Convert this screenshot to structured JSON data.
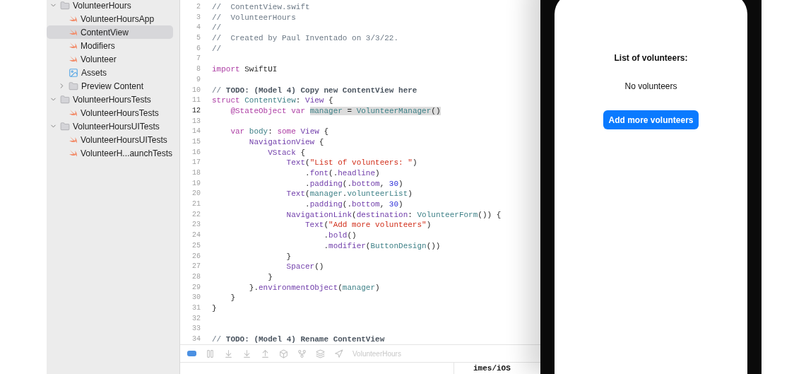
{
  "navigator": {
    "items": [
      {
        "kind": "folder",
        "label": "VolunteerHours",
        "expanded": true,
        "selected": false,
        "children": [
          {
            "kind": "swift",
            "label": "VolunteerHoursApp",
            "selected": false
          },
          {
            "kind": "swift",
            "label": "ContentView",
            "selected": true
          },
          {
            "kind": "swift",
            "label": "Modifiers",
            "selected": false
          },
          {
            "kind": "swift",
            "label": "Volunteer",
            "selected": false
          },
          {
            "kind": "assets",
            "label": "Assets",
            "selected": false
          },
          {
            "kind": "folder",
            "label": "Preview Content",
            "expanded": false,
            "selected": false
          }
        ]
      },
      {
        "kind": "folder",
        "label": "VolunteerHoursTests",
        "expanded": true,
        "selected": false,
        "children": [
          {
            "kind": "swift",
            "label": "VolunteerHoursTests",
            "selected": false
          }
        ]
      },
      {
        "kind": "folder",
        "label": "VolunteerHoursUITests",
        "expanded": true,
        "selected": false,
        "children": [
          {
            "kind": "swift",
            "label": "VolunteerHoursUITests",
            "selected": false
          },
          {
            "kind": "swift",
            "label": "VolunteerH...aunchTests",
            "selected": false
          }
        ]
      }
    ]
  },
  "editor": {
    "lines": [
      {
        "number": "2",
        "current": false,
        "tokens": [
          {
            "kind": "comment",
            "text": "//  ContentView.swift"
          }
        ]
      },
      {
        "number": "3",
        "current": false,
        "tokens": [
          {
            "kind": "comment",
            "text": "//  VolunteerHours"
          }
        ]
      },
      {
        "number": "4",
        "current": false,
        "tokens": [
          {
            "kind": "comment",
            "text": "//"
          }
        ]
      },
      {
        "number": "5",
        "current": false,
        "tokens": [
          {
            "kind": "comment",
            "text": "//  Created by Paul Inventado on 3/3/22."
          }
        ]
      },
      {
        "number": "6",
        "current": false,
        "tokens": [
          {
            "kind": "comment",
            "text": "//"
          }
        ]
      },
      {
        "number": "7",
        "current": false
      },
      {
        "number": "8",
        "current": false,
        "tokens": [
          {
            "kind": "keyword",
            "text": "import"
          },
          {
            "kind": "plain",
            "text": " SwiftUI"
          }
        ]
      },
      {
        "number": "9",
        "current": false
      },
      {
        "number": "10",
        "current": false,
        "tokens": [
          {
            "kind": "comment",
            "text": "// "
          },
          {
            "kind": "todo",
            "text": "TODO: (Model 4) Copy new ContentView here"
          }
        ]
      },
      {
        "number": "11",
        "current": false,
        "tokens": [
          {
            "kind": "keyword",
            "text": "struct "
          },
          {
            "kind": "ident",
            "text": "ContentView"
          },
          {
            "kind": "plain",
            "text": ": "
          },
          {
            "kind": "type",
            "text": "View"
          },
          {
            "kind": "plain",
            "text": " {"
          }
        ]
      },
      {
        "number": "12",
        "current": true,
        "tokens": [
          {
            "kind": "keyword",
            "text": "    @StateObject"
          },
          {
            "kind": "keyword",
            "text": " var "
          },
          {
            "kind": "ident",
            "text": "manager",
            "highlighted": true
          },
          {
            "kind": "plain",
            "text": " = ",
            "highlighted": true
          },
          {
            "kind": "ident",
            "text": "VolunteerManager",
            "highlighted": true
          },
          {
            "kind": "plain",
            "text": "()",
            "highlighted": true
          }
        ]
      },
      {
        "number": "13",
        "current": false
      },
      {
        "number": "14",
        "current": false,
        "tokens": [
          {
            "kind": "keyword",
            "text": "    var "
          },
          {
            "kind": "ident",
            "text": "body"
          },
          {
            "kind": "plain",
            "text": ": "
          },
          {
            "kind": "keyword",
            "text": "some "
          },
          {
            "kind": "type",
            "text": "View"
          },
          {
            "kind": "plain",
            "text": " {"
          }
        ]
      },
      {
        "number": "15",
        "current": false,
        "tokens": [
          {
            "kind": "type",
            "text": "        NavigationView"
          },
          {
            "kind": "plain",
            "text": " {"
          }
        ]
      },
      {
        "number": "16",
        "current": false,
        "tokens": [
          {
            "kind": "type",
            "text": "            VStack"
          },
          {
            "kind": "plain",
            "text": " {"
          }
        ]
      },
      {
        "number": "17",
        "current": false,
        "tokens": [
          {
            "kind": "type",
            "text": "                Text"
          },
          {
            "kind": "plain",
            "text": "("
          },
          {
            "kind": "string",
            "text": "\"List of volunteers: \""
          },
          {
            "kind": "plain",
            "text": ")"
          }
        ]
      },
      {
        "number": "18",
        "current": false,
        "tokens": [
          {
            "kind": "plain",
            "text": "                    ."
          },
          {
            "kind": "type",
            "text": "font"
          },
          {
            "kind": "plain",
            "text": "(."
          },
          {
            "kind": "type",
            "text": "headline"
          },
          {
            "kind": "plain",
            "text": ")"
          }
        ]
      },
      {
        "number": "19",
        "current": false,
        "tokens": [
          {
            "kind": "plain",
            "text": "                    ."
          },
          {
            "kind": "type",
            "text": "padding"
          },
          {
            "kind": "plain",
            "text": "(."
          },
          {
            "kind": "type",
            "text": "bottom"
          },
          {
            "kind": "plain",
            "text": ", "
          },
          {
            "kind": "number",
            "text": "30"
          },
          {
            "kind": "plain",
            "text": ")"
          }
        ]
      },
      {
        "number": "20",
        "current": false,
        "tokens": [
          {
            "kind": "type",
            "text": "                Text"
          },
          {
            "kind": "plain",
            "text": "("
          },
          {
            "kind": "ident",
            "text": "manager"
          },
          {
            "kind": "plain",
            "text": "."
          },
          {
            "kind": "ident",
            "text": "volunteerList"
          },
          {
            "kind": "plain",
            "text": ")"
          }
        ]
      },
      {
        "number": "21",
        "current": false,
        "tokens": [
          {
            "kind": "plain",
            "text": "                    ."
          },
          {
            "kind": "type",
            "text": "padding"
          },
          {
            "kind": "plain",
            "text": "(."
          },
          {
            "kind": "type",
            "text": "bottom"
          },
          {
            "kind": "plain",
            "text": ", "
          },
          {
            "kind": "number",
            "text": "30"
          },
          {
            "kind": "plain",
            "text": ")"
          }
        ]
      },
      {
        "number": "22",
        "current": false,
        "tokens": [
          {
            "kind": "type",
            "text": "                NavigationLink"
          },
          {
            "kind": "plain",
            "text": "("
          },
          {
            "kind": "type",
            "text": "destination"
          },
          {
            "kind": "plain",
            "text": ": "
          },
          {
            "kind": "ident",
            "text": "VolunteerForm"
          },
          {
            "kind": "plain",
            "text": "()) {"
          }
        ]
      },
      {
        "number": "23",
        "current": false,
        "tokens": [
          {
            "kind": "type",
            "text": "                    Text"
          },
          {
            "kind": "plain",
            "text": "("
          },
          {
            "kind": "string",
            "text": "\"Add more volunteers\""
          },
          {
            "kind": "plain",
            "text": ")"
          }
        ]
      },
      {
        "number": "24",
        "current": false,
        "tokens": [
          {
            "kind": "plain",
            "text": "                        ."
          },
          {
            "kind": "type",
            "text": "bold"
          },
          {
            "kind": "plain",
            "text": "()"
          }
        ]
      },
      {
        "number": "25",
        "current": false,
        "tokens": [
          {
            "kind": "plain",
            "text": "                        ."
          },
          {
            "kind": "type",
            "text": "modifier"
          },
          {
            "kind": "plain",
            "text": "("
          },
          {
            "kind": "ident",
            "text": "ButtonDesign"
          },
          {
            "kind": "plain",
            "text": "())"
          }
        ]
      },
      {
        "number": "26",
        "current": false,
        "tokens": [
          {
            "kind": "plain",
            "text": "                }"
          }
        ]
      },
      {
        "number": "27",
        "current": false,
        "tokens": [
          {
            "kind": "type",
            "text": "                Spacer"
          },
          {
            "kind": "plain",
            "text": "()"
          }
        ]
      },
      {
        "number": "28",
        "current": false,
        "tokens": [
          {
            "kind": "plain",
            "text": "            }"
          }
        ]
      },
      {
        "number": "29",
        "current": false,
        "tokens": [
          {
            "kind": "plain",
            "text": "        }."
          },
          {
            "kind": "type",
            "text": "environmentObject"
          },
          {
            "kind": "plain",
            "text": "("
          },
          {
            "kind": "ident",
            "text": "manager"
          },
          {
            "kind": "plain",
            "text": ")"
          }
        ]
      },
      {
        "number": "30",
        "current": false,
        "tokens": [
          {
            "kind": "plain",
            "text": "    }"
          }
        ]
      },
      {
        "number": "31",
        "current": false,
        "tokens": [
          {
            "kind": "plain",
            "text": "}"
          }
        ]
      },
      {
        "number": "32",
        "current": false
      },
      {
        "number": "33",
        "current": false
      },
      {
        "number": "34",
        "current": false,
        "tokens": [
          {
            "kind": "comment",
            "text": "// "
          },
          {
            "kind": "todo",
            "text": "TODO: (Model 4) Rename ContentView"
          }
        ]
      }
    ]
  },
  "debug_bar": {
    "breakpoints_active": true,
    "scheme": "VolunteerHours"
  },
  "console": {
    "text": "imes/iOS"
  },
  "simulator": {
    "title": "List of volunteers:",
    "message": "No volunteers",
    "button": "Add more volunteers"
  }
}
